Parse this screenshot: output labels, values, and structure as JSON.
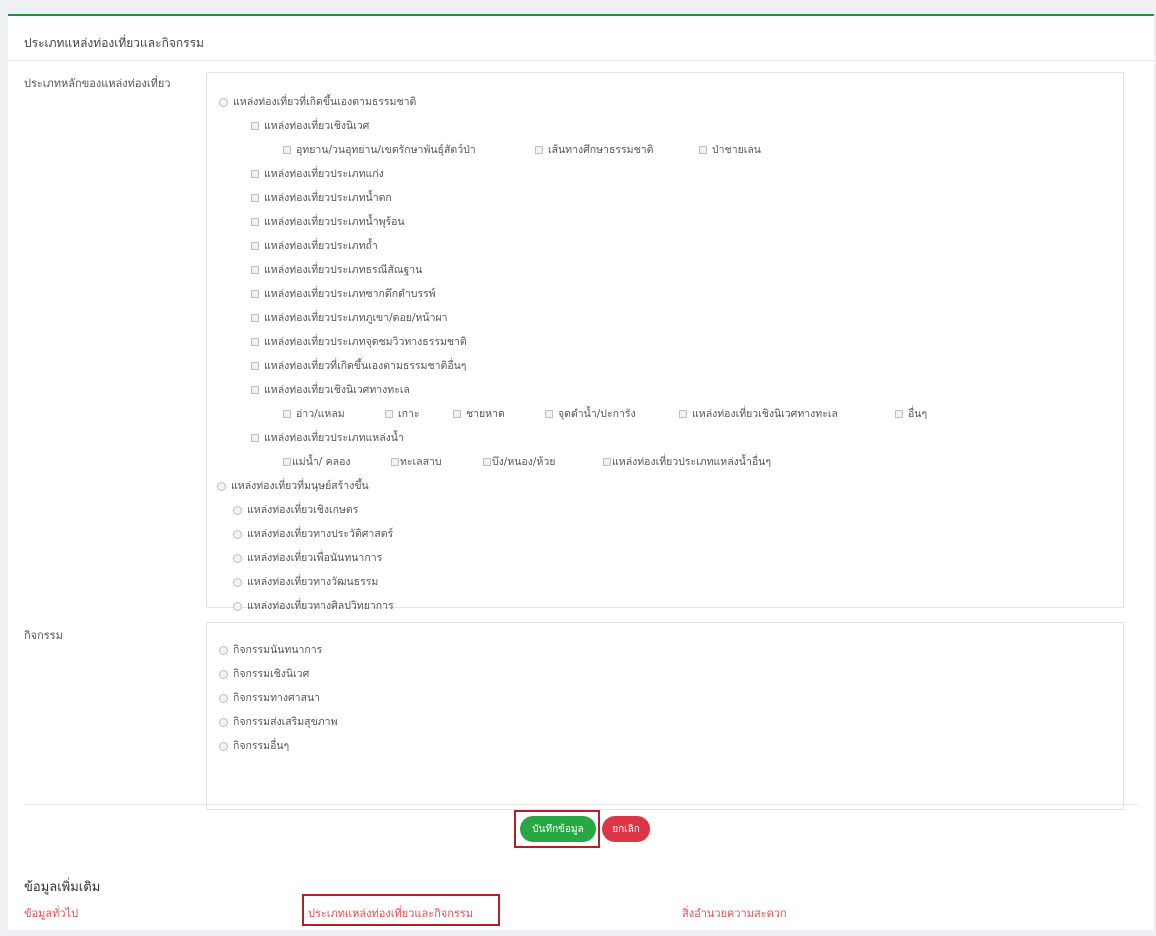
{
  "card": {
    "title": "ประเภทแหล่งท่องเที่ยวและกิจกรรม"
  },
  "attraction": {
    "label": "ประเภทหลักของแหล่งท่องเที่ยว",
    "natural": {
      "label": "แหล่งท่องเที่ยวที่เกิดขึ้นเองตามธรรมชาติ",
      "eco": {
        "label": "แหล่งท่องเที่ยวเชิงนิเวศ",
        "items": [
          "อุทยาน/วนอุทยาน/เขตรักษาพันธุ์สัตว์ป่า",
          "เส้นทางศึกษาธรรมชาติ",
          "ป่าชายเลน"
        ]
      },
      "types": [
        "แหล่งท่องเที่ยวประเภทแก่ง",
        "แหล่งท่องเที่ยวประเภทน้ำตก",
        "แหล่งท่องเที่ยวประเภทน้ำพุร้อน",
        "แหล่งท่องเที่ยวประเภทถ้ำ",
        "แหล่งท่องเที่ยวประเภทธรณีสัณฐาน",
        "แหล่งท่องเที่ยวประเภทซากดึกดำบรรพ์",
        "แหล่งท่องเที่ยวประเภทภูเขา/ดอย/หน้าผา",
        "แหล่งท่องเที่ยวประเภทจุดชมวิวทางธรรมชาติ",
        "แหล่งท่องเที่ยวที่เกิดขึ้นเองตามธรรมชาติอื่นๆ"
      ],
      "marine": {
        "label": "แหล่งท่องเที่ยวเชิงนิเวศทางทะเล",
        "items": [
          "อ่าว/แหลม",
          "เกาะ",
          "ชายหาด",
          "จุดดำน้ำ/ปะการัง",
          "แหล่งท่องเที่ยวเชิงนิเวศทางทะเล",
          "อื่นๆ"
        ]
      },
      "water": {
        "label": "แหล่งท่องเที่ยวประเภทแหล่งน้ำ",
        "items": [
          "แม่น้ำ/ คลอง",
          "ทะเลสาบ",
          "บึง/หนอง/ห้วย",
          "แหล่งท่องเที่ยวประเภทแหล่งน้ำอื่นๆ"
        ]
      }
    },
    "manmade": {
      "label": "แหล่งท่องเที่ยวที่มนุษย์สร้างขึ้น",
      "items": [
        "แหล่งท่องเที่ยวเชิงเกษตร",
        "แหล่งท่องเที่ยวทางประวัติศาสตร์",
        "แหล่งท่องเที่ยวเพื่อนันทนาการ",
        "แหล่งท่องเที่ยวทางวัฒนธรรม",
        "แหล่งท่องเที่ยวทางศิลปวิทยาการ"
      ]
    }
  },
  "activity": {
    "label": "กิจกรรม",
    "items": [
      "กิจกรรมนันทนาการ",
      "กิจกรรมเชิงนิเวศ",
      "กิจกรรมทางศาสนา",
      "กิจกรรมส่งเสริมสุขภาพ",
      "กิจกรรมอื่นๆ"
    ]
  },
  "buttons": {
    "save": "บันทึกข้อมูล",
    "cancel": "ยกเลิก"
  },
  "more": {
    "title": "ข้อมูลเพิ่มเติม",
    "links": [
      "ข้อมูลทั่วไป",
      "ประเภทแหล่งท่องเที่ยวและกิจกรรม",
      "สิ่งอำนวยความสะดวก"
    ]
  },
  "colors": {
    "accent": "#2e8b3e",
    "save": "#28a745",
    "cancel": "#dc3545",
    "link": "#d9534f",
    "highlight": "#b0202a"
  }
}
